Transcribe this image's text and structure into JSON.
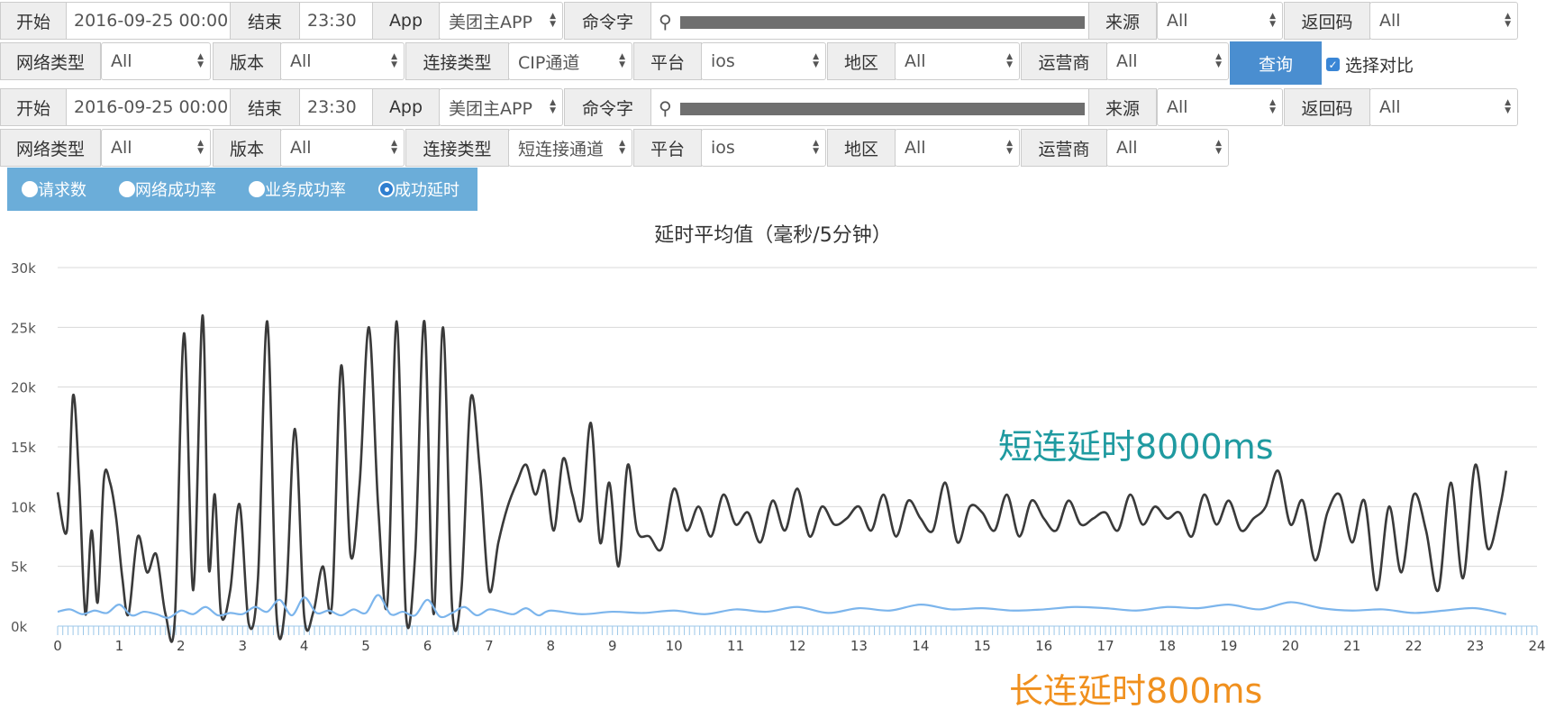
{
  "rows": [
    {
      "start_label": "开始",
      "start_value": "2016-09-25 00:00",
      "end_label": "结束",
      "end_value": "23:30",
      "app_label": "App",
      "app_value": "美团主APP",
      "cmd_label": "命令字",
      "source_label": "来源",
      "source_value": "All",
      "code_label": "返回码",
      "code_value": "All"
    },
    {
      "net_label": "网络类型",
      "net_value": "All",
      "ver_label": "版本",
      "ver_value": "All",
      "conn_label": "连接类型",
      "conn_value": "CIP通道",
      "plat_label": "平台",
      "plat_value": "ios",
      "region_label": "地区",
      "region_value": "All",
      "carrier_label": "运营商",
      "carrier_value": "All"
    },
    {
      "start_label": "开始",
      "start_value": "2016-09-25 00:00",
      "end_label": "结束",
      "end_value": "23:30",
      "app_label": "App",
      "app_value": "美团主APP",
      "cmd_label": "命令字",
      "source_label": "来源",
      "source_value": "All",
      "code_label": "返回码",
      "code_value": "All"
    },
    {
      "net_label": "网络类型",
      "net_value": "All",
      "ver_label": "版本",
      "ver_value": "All",
      "conn_label": "连接类型",
      "conn_value": "短连接通道",
      "plat_label": "平台",
      "plat_value": "ios",
      "region_label": "地区",
      "region_value": "All",
      "carrier_label": "运营商",
      "carrier_value": "All"
    }
  ],
  "query_button": "查询",
  "compare_label": "选择对比",
  "radios": [
    {
      "label": "请求数"
    },
    {
      "label": "网络成功率"
    },
    {
      "label": "业务成功率"
    },
    {
      "label": "成功延时",
      "selected": true
    }
  ],
  "annotations": {
    "short": "短连延时8000ms",
    "long": "长连延时800ms"
  },
  "colors": {
    "short_series": "#3a3a3a",
    "long_series": "#7cb5ec",
    "annotation_short": "#1f9aa0",
    "annotation_long": "#f0901e",
    "button": "#4a8ed0",
    "radio_bar": "#6badd9"
  },
  "chart_data": {
    "type": "line",
    "title": "延时平均值（毫秒/5分钟）",
    "xlim": [
      0,
      24
    ],
    "ylim": [
      0,
      30000
    ],
    "x_ticks": [
      0,
      1,
      2,
      3,
      4,
      5,
      6,
      7,
      8,
      9,
      10,
      11,
      12,
      13,
      14,
      15,
      16,
      17,
      18,
      19,
      20,
      21,
      22,
      23,
      24
    ],
    "y_ticks": [
      {
        "v": 0,
        "label": "0k"
      },
      {
        "v": 5000,
        "label": "5k"
      },
      {
        "v": 10000,
        "label": "10k"
      },
      {
        "v": 15000,
        "label": "15k"
      },
      {
        "v": 20000,
        "label": "20k"
      },
      {
        "v": 25000,
        "label": "25k"
      },
      {
        "v": 30000,
        "label": "30k"
      }
    ],
    "grid": true,
    "series": [
      {
        "key": "short",
        "x": [
          0,
          0.15,
          0.25,
          0.35,
          0.45,
          0.55,
          0.65,
          0.75,
          0.85,
          0.95,
          1.05,
          1.15,
          1.3,
          1.45,
          1.6,
          1.75,
          1.9,
          2.05,
          2.2,
          2.35,
          2.45,
          2.55,
          2.65,
          2.8,
          2.95,
          3.1,
          3.25,
          3.4,
          3.55,
          3.7,
          3.85,
          4.0,
          4.15,
          4.3,
          4.45,
          4.6,
          4.75,
          4.9,
          5.05,
          5.2,
          5.35,
          5.5,
          5.65,
          5.8,
          5.95,
          6.1,
          6.25,
          6.4,
          6.55,
          6.7,
          6.85,
          7.0,
          7.15,
          7.3,
          7.45,
          7.6,
          7.75,
          7.9,
          8.05,
          8.2,
          8.35,
          8.5,
          8.65,
          8.8,
          8.95,
          9.1,
          9.25,
          9.4,
          9.6,
          9.8,
          10.0,
          10.2,
          10.4,
          10.6,
          10.8,
          11.0,
          11.2,
          11.4,
          11.6,
          11.8,
          12.0,
          12.2,
          12.4,
          12.6,
          12.8,
          13.0,
          13.2,
          13.4,
          13.6,
          13.8,
          14.0,
          14.2,
          14.4,
          14.6,
          14.8,
          15.0,
          15.2,
          15.4,
          15.6,
          15.8,
          16.0,
          16.2,
          16.4,
          16.6,
          16.8,
          17.0,
          17.2,
          17.4,
          17.6,
          17.8,
          18.0,
          18.2,
          18.4,
          18.6,
          18.8,
          19.0,
          19.2,
          19.4,
          19.6,
          19.8,
          20.0,
          20.2,
          20.4,
          20.6,
          20.8,
          21.0,
          21.2,
          21.4,
          21.6,
          21.8,
          22.0,
          22.2,
          22.4,
          22.6,
          22.8,
          23.0,
          23.2,
          23.4,
          23.5
        ],
        "values": [
          11200,
          8000,
          19300,
          12000,
          1000,
          8000,
          2000,
          12300,
          12000,
          9000,
          4000,
          1000,
          7500,
          4500,
          6000,
          1000,
          500,
          24500,
          3000,
          26000,
          5000,
          11000,
          1000,
          3000,
          10200,
          200,
          4000,
          25500,
          1000,
          2000,
          16500,
          800,
          1200,
          5000,
          1800,
          21800,
          6000,
          12000,
          25000,
          10000,
          2000,
          25500,
          1000,
          6000,
          25500,
          1000,
          25000,
          1500,
          3000,
          19000,
          13000,
          3000,
          7000,
          10000,
          12000,
          13500,
          11000,
          13000,
          8000,
          14000,
          11000,
          9000,
          17000,
          7000,
          12000,
          5000,
          13500,
          8000,
          7500,
          6500,
          11500,
          8000,
          10000,
          7500,
          11000,
          8500,
          9500,
          7000,
          10500,
          8000,
          11500,
          7500,
          10000,
          8500,
          9000,
          10000,
          8000,
          11000,
          7500,
          10500,
          9000,
          8000,
          12000,
          7000,
          10000,
          9500,
          8000,
          11000,
          7500,
          10500,
          9000,
          8000,
          10500,
          8500,
          9000,
          9500,
          8000,
          11000,
          8500,
          10000,
          9000,
          9500,
          7500,
          11000,
          8500,
          10500,
          8000,
          9000,
          10000,
          13000,
          8500,
          10500,
          5500,
          9500,
          11000,
          7000,
          10500,
          3000,
          10000,
          4500,
          11000,
          8000,
          3000,
          12000,
          4000,
          13500,
          6500,
          10000,
          13000
        ]
      },
      {
        "key": "long",
        "x": [
          0,
          0.2,
          0.4,
          0.6,
          0.8,
          1.0,
          1.2,
          1.4,
          1.6,
          1.8,
          2.0,
          2.2,
          2.4,
          2.6,
          2.8,
          3.0,
          3.2,
          3.4,
          3.6,
          3.8,
          4.0,
          4.2,
          4.4,
          4.6,
          4.8,
          5.0,
          5.2,
          5.4,
          5.6,
          5.8,
          6.0,
          6.2,
          6.4,
          6.6,
          6.8,
          7.0,
          7.2,
          7.4,
          7.6,
          7.8,
          8.0,
          8.5,
          9.0,
          9.5,
          10.0,
          10.5,
          11.0,
          11.5,
          12.0,
          12.5,
          13.0,
          13.5,
          14.0,
          14.5,
          15.0,
          15.5,
          16.0,
          16.5,
          17.0,
          17.5,
          18.0,
          18.5,
          19.0,
          19.5,
          20.0,
          20.5,
          21.0,
          21.5,
          22.0,
          22.5,
          23.0,
          23.5
        ],
        "values": [
          1200,
          1400,
          1000,
          1300,
          1100,
          1800,
          900,
          1200,
          1000,
          700,
          1300,
          1000,
          1600,
          900,
          1100,
          1000,
          1600,
          1200,
          2200,
          900,
          2400,
          1100,
          1300,
          900,
          1400,
          1100,
          2600,
          1000,
          1200,
          900,
          2200,
          800,
          1100,
          1600,
          900,
          1400,
          1200,
          1000,
          1500,
          900,
          1300,
          1000,
          1200,
          1100,
          1300,
          1000,
          1400,
          1200,
          1600,
          1100,
          1500,
          1300,
          1800,
          1400,
          1500,
          1300,
          1400,
          1600,
          1500,
          1300,
          1600,
          1500,
          1800,
          1400,
          2000,
          1500,
          1300,
          1400,
          1100,
          1300,
          1500,
          1000
        ]
      }
    ]
  }
}
